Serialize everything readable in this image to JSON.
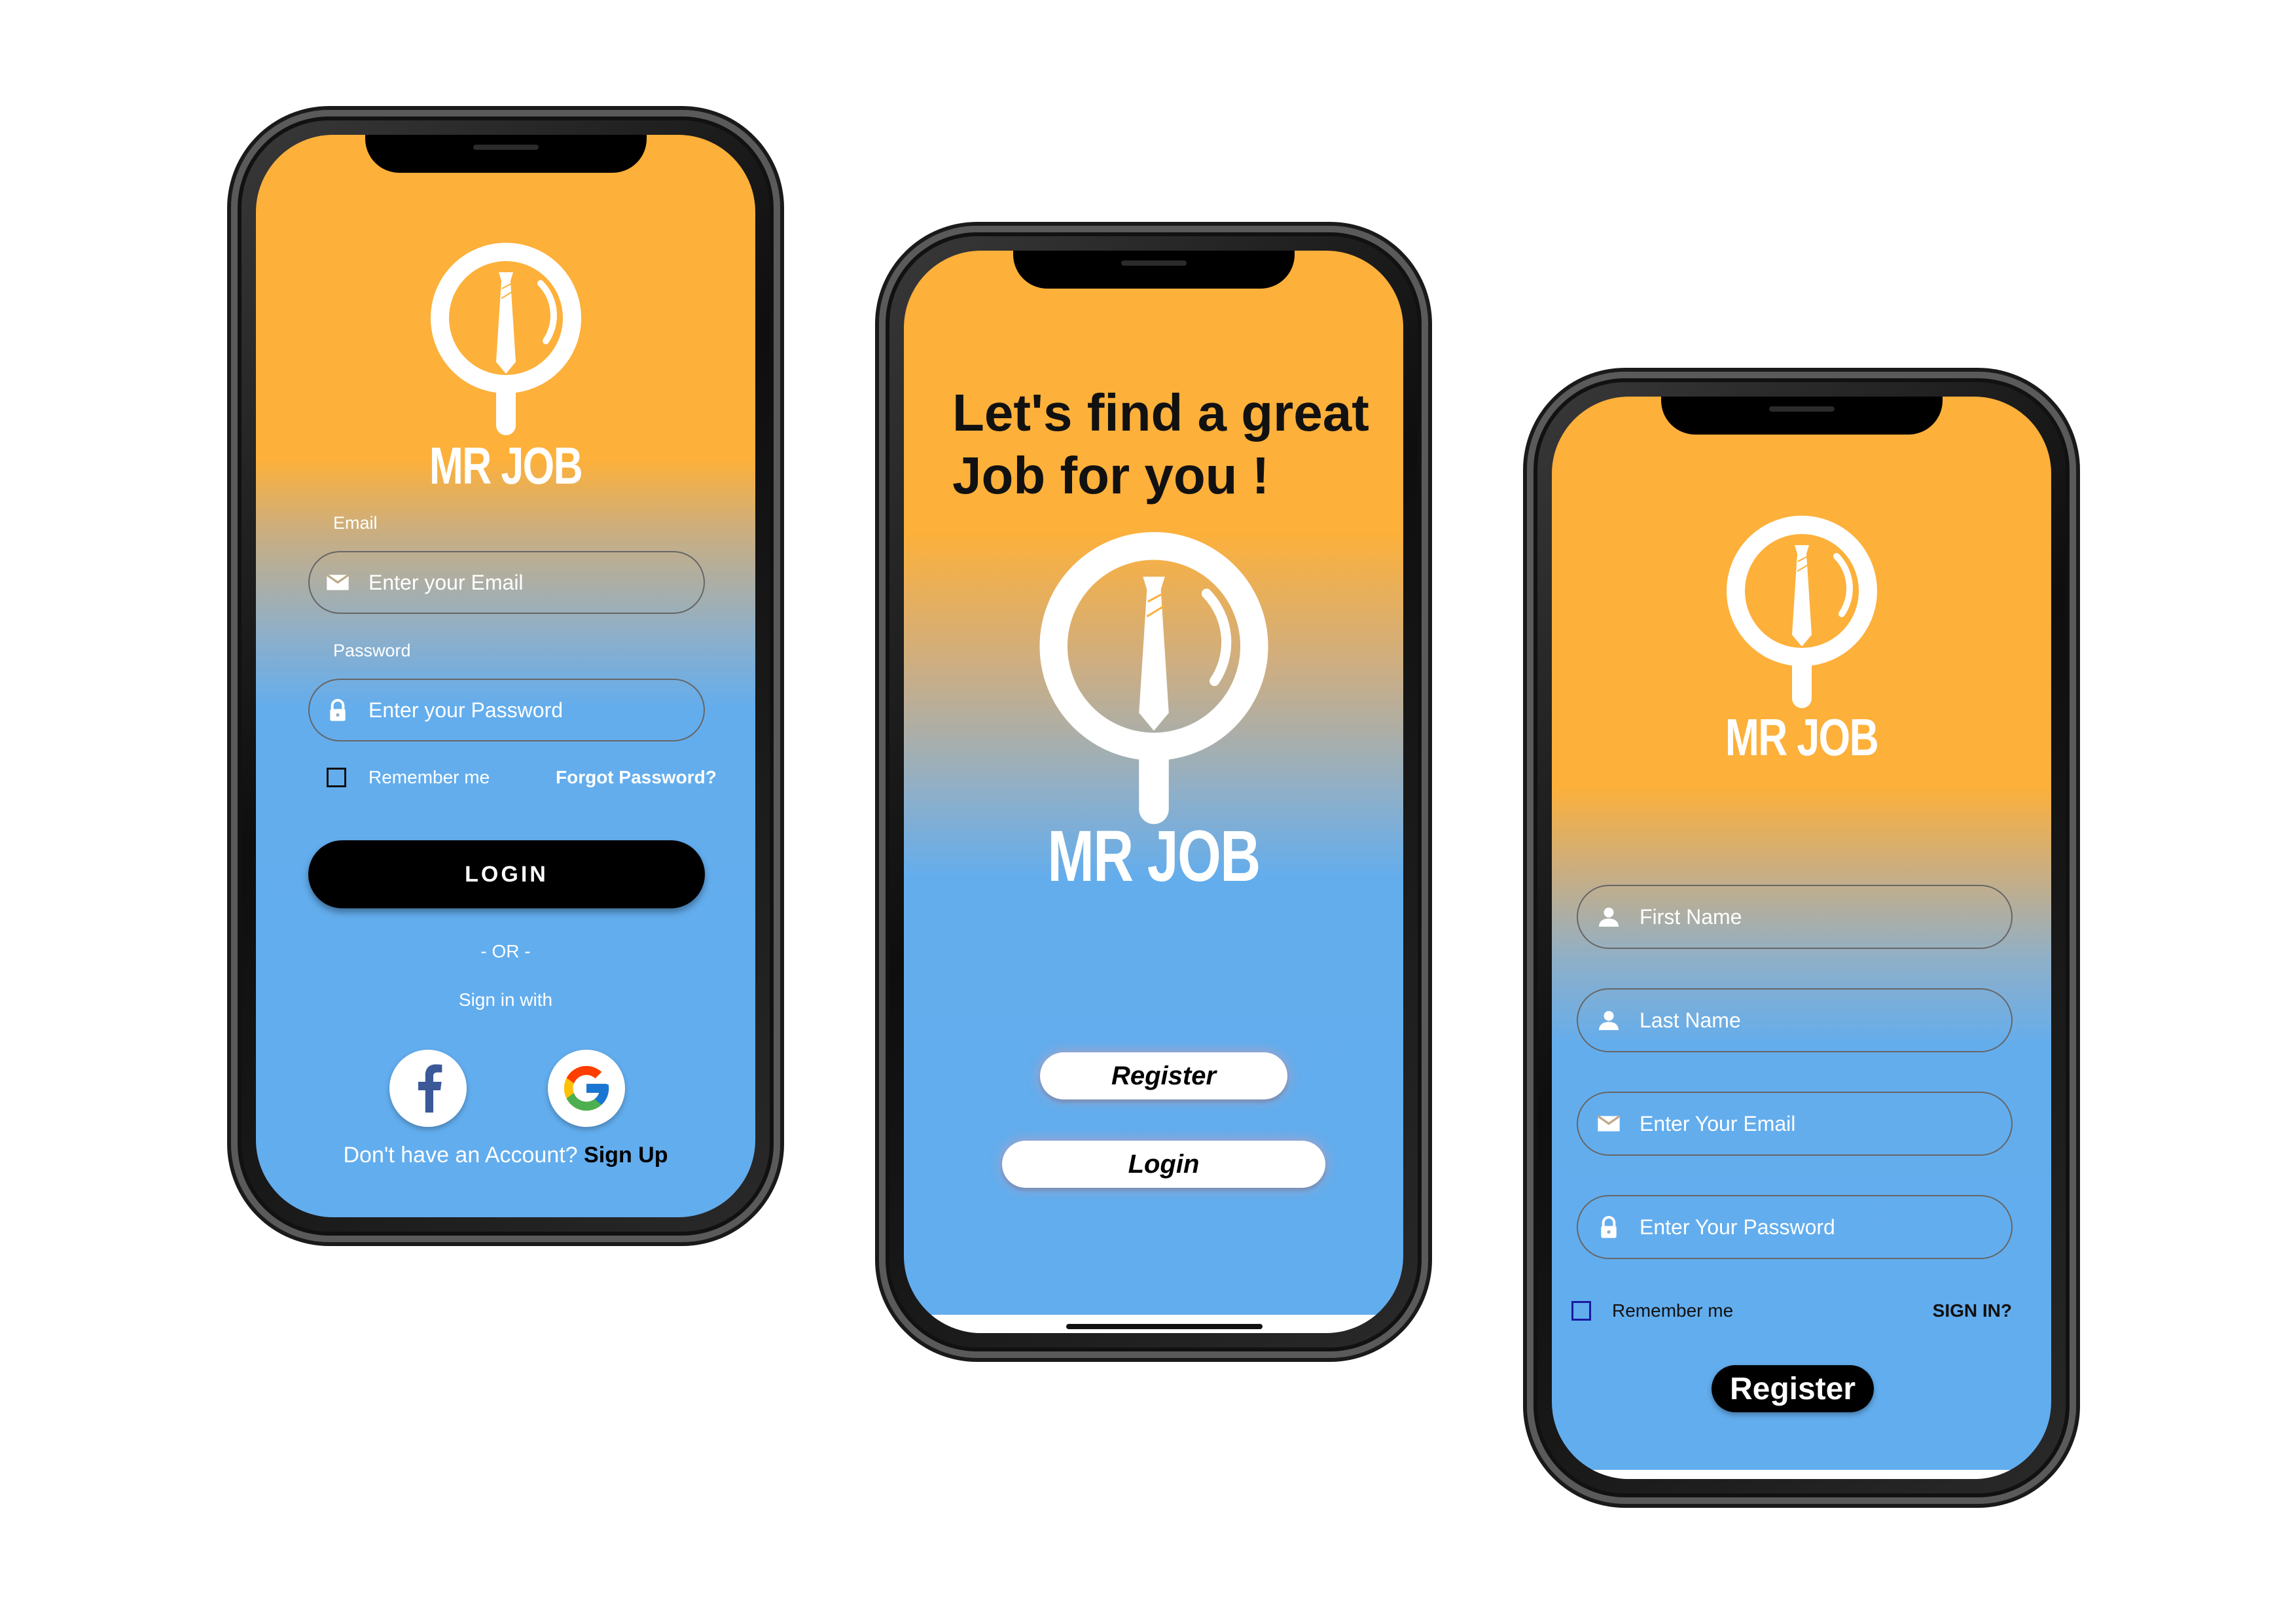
{
  "brand": {
    "name": "MR JOB"
  },
  "login_screen": {
    "email_label": "Email",
    "email_placeholder": "Enter your Email",
    "password_label": "Password",
    "password_placeholder": "Enter your Password",
    "remember_label": "Remember me",
    "forgot_label": "Forgot Password?",
    "login_button": "LOGIN",
    "or_text": "- OR -",
    "sign_in_with": "Sign in with",
    "no_account": "Don't have an Account?",
    "sign_up": "Sign Up"
  },
  "welcome_screen": {
    "headline_line1": "Let's find a great",
    "headline_line2": "Job for you !",
    "register_button": "Register",
    "login_button": "Login"
  },
  "register_screen": {
    "first_name_placeholder": "First Name",
    "last_name_placeholder": "Last Name",
    "email_placeholder": "Enter Your Email",
    "password_placeholder": "Enter Your Password",
    "remember_label": "Remember me",
    "sign_in_label": "SIGN IN?",
    "register_button": "Register"
  },
  "colors": {
    "orange": "#fdb03a",
    "blue": "#62adee",
    "black": "#000000",
    "white": "#ffffff"
  },
  "icons": [
    "mail-icon",
    "lock-icon",
    "person-icon",
    "facebook-icon",
    "google-icon",
    "magnifier-tie-logo"
  ]
}
